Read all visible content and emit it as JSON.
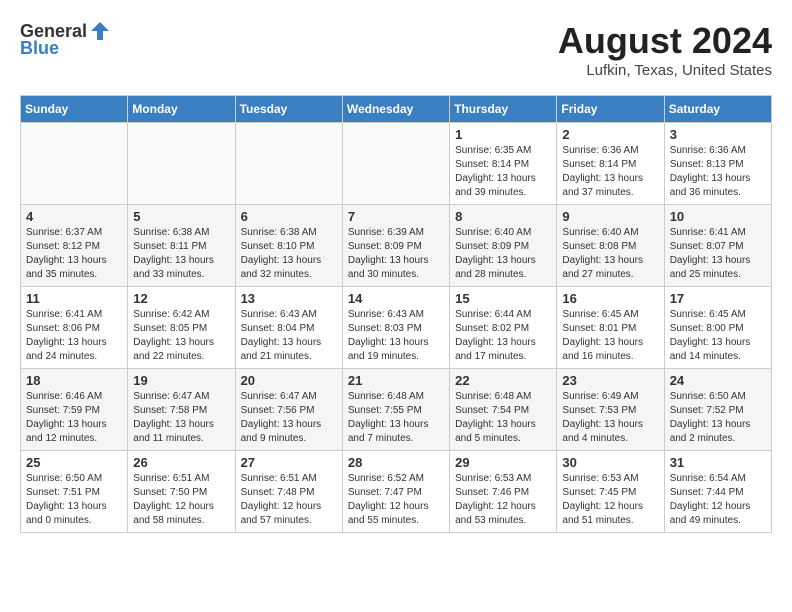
{
  "header": {
    "logo_general": "General",
    "logo_blue": "Blue",
    "month_year": "August 2024",
    "location": "Lufkin, Texas, United States"
  },
  "days_of_week": [
    "Sunday",
    "Monday",
    "Tuesday",
    "Wednesday",
    "Thursday",
    "Friday",
    "Saturday"
  ],
  "weeks": [
    [
      {
        "day": "",
        "detail": ""
      },
      {
        "day": "",
        "detail": ""
      },
      {
        "day": "",
        "detail": ""
      },
      {
        "day": "",
        "detail": ""
      },
      {
        "day": "1",
        "detail": "Sunrise: 6:35 AM\nSunset: 8:14 PM\nDaylight: 13 hours\nand 39 minutes."
      },
      {
        "day": "2",
        "detail": "Sunrise: 6:36 AM\nSunset: 8:14 PM\nDaylight: 13 hours\nand 37 minutes."
      },
      {
        "day": "3",
        "detail": "Sunrise: 6:36 AM\nSunset: 8:13 PM\nDaylight: 13 hours\nand 36 minutes."
      }
    ],
    [
      {
        "day": "4",
        "detail": "Sunrise: 6:37 AM\nSunset: 8:12 PM\nDaylight: 13 hours\nand 35 minutes."
      },
      {
        "day": "5",
        "detail": "Sunrise: 6:38 AM\nSunset: 8:11 PM\nDaylight: 13 hours\nand 33 minutes."
      },
      {
        "day": "6",
        "detail": "Sunrise: 6:38 AM\nSunset: 8:10 PM\nDaylight: 13 hours\nand 32 minutes."
      },
      {
        "day": "7",
        "detail": "Sunrise: 6:39 AM\nSunset: 8:09 PM\nDaylight: 13 hours\nand 30 minutes."
      },
      {
        "day": "8",
        "detail": "Sunrise: 6:40 AM\nSunset: 8:09 PM\nDaylight: 13 hours\nand 28 minutes."
      },
      {
        "day": "9",
        "detail": "Sunrise: 6:40 AM\nSunset: 8:08 PM\nDaylight: 13 hours\nand 27 minutes."
      },
      {
        "day": "10",
        "detail": "Sunrise: 6:41 AM\nSunset: 8:07 PM\nDaylight: 13 hours\nand 25 minutes."
      }
    ],
    [
      {
        "day": "11",
        "detail": "Sunrise: 6:41 AM\nSunset: 8:06 PM\nDaylight: 13 hours\nand 24 minutes."
      },
      {
        "day": "12",
        "detail": "Sunrise: 6:42 AM\nSunset: 8:05 PM\nDaylight: 13 hours\nand 22 minutes."
      },
      {
        "day": "13",
        "detail": "Sunrise: 6:43 AM\nSunset: 8:04 PM\nDaylight: 13 hours\nand 21 minutes."
      },
      {
        "day": "14",
        "detail": "Sunrise: 6:43 AM\nSunset: 8:03 PM\nDaylight: 13 hours\nand 19 minutes."
      },
      {
        "day": "15",
        "detail": "Sunrise: 6:44 AM\nSunset: 8:02 PM\nDaylight: 13 hours\nand 17 minutes."
      },
      {
        "day": "16",
        "detail": "Sunrise: 6:45 AM\nSunset: 8:01 PM\nDaylight: 13 hours\nand 16 minutes."
      },
      {
        "day": "17",
        "detail": "Sunrise: 6:45 AM\nSunset: 8:00 PM\nDaylight: 13 hours\nand 14 minutes."
      }
    ],
    [
      {
        "day": "18",
        "detail": "Sunrise: 6:46 AM\nSunset: 7:59 PM\nDaylight: 13 hours\nand 12 minutes."
      },
      {
        "day": "19",
        "detail": "Sunrise: 6:47 AM\nSunset: 7:58 PM\nDaylight: 13 hours\nand 11 minutes."
      },
      {
        "day": "20",
        "detail": "Sunrise: 6:47 AM\nSunset: 7:56 PM\nDaylight: 13 hours\nand 9 minutes."
      },
      {
        "day": "21",
        "detail": "Sunrise: 6:48 AM\nSunset: 7:55 PM\nDaylight: 13 hours\nand 7 minutes."
      },
      {
        "day": "22",
        "detail": "Sunrise: 6:48 AM\nSunset: 7:54 PM\nDaylight: 13 hours\nand 5 minutes."
      },
      {
        "day": "23",
        "detail": "Sunrise: 6:49 AM\nSunset: 7:53 PM\nDaylight: 13 hours\nand 4 minutes."
      },
      {
        "day": "24",
        "detail": "Sunrise: 6:50 AM\nSunset: 7:52 PM\nDaylight: 13 hours\nand 2 minutes."
      }
    ],
    [
      {
        "day": "25",
        "detail": "Sunrise: 6:50 AM\nSunset: 7:51 PM\nDaylight: 13 hours\nand 0 minutes."
      },
      {
        "day": "26",
        "detail": "Sunrise: 6:51 AM\nSunset: 7:50 PM\nDaylight: 12 hours\nand 58 minutes."
      },
      {
        "day": "27",
        "detail": "Sunrise: 6:51 AM\nSunset: 7:48 PM\nDaylight: 12 hours\nand 57 minutes."
      },
      {
        "day": "28",
        "detail": "Sunrise: 6:52 AM\nSunset: 7:47 PM\nDaylight: 12 hours\nand 55 minutes."
      },
      {
        "day": "29",
        "detail": "Sunrise: 6:53 AM\nSunset: 7:46 PM\nDaylight: 12 hours\nand 53 minutes."
      },
      {
        "day": "30",
        "detail": "Sunrise: 6:53 AM\nSunset: 7:45 PM\nDaylight: 12 hours\nand 51 minutes."
      },
      {
        "day": "31",
        "detail": "Sunrise: 6:54 AM\nSunset: 7:44 PM\nDaylight: 12 hours\nand 49 minutes."
      }
    ]
  ]
}
